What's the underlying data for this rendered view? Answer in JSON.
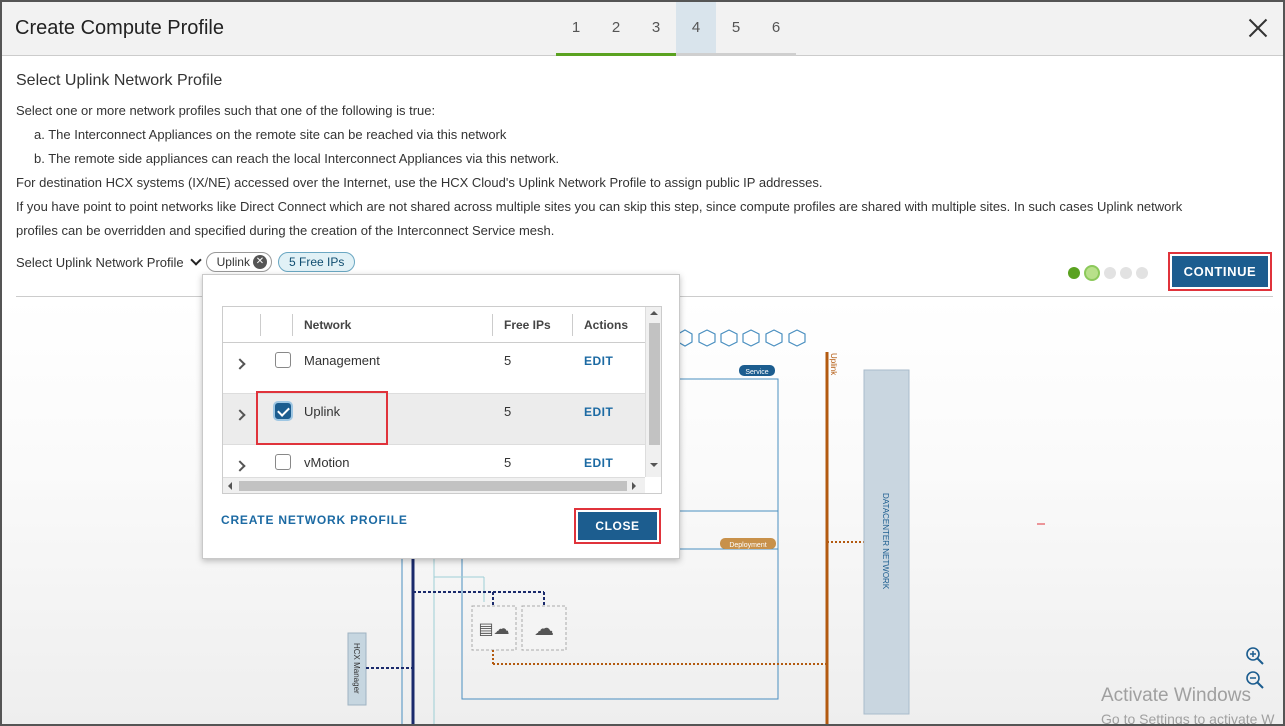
{
  "dialog": {
    "title": "Create Compute Profile",
    "steps": [
      "1",
      "2",
      "3",
      "4",
      "5",
      "6"
    ]
  },
  "content": {
    "section_title": "Select Uplink Network Profile",
    "intro": "Select one or more network profiles such that one of the following is true:",
    "point_a": "a. The Interconnect Appliances on the remote site can be reached via this network",
    "point_b": "b. The remote side appliances can reach the local Interconnect Appliances via this network.",
    "para_internet": "For destination HCX systems (IX/NE) accessed over the Internet, use the HCX Cloud's Uplink Network Profile to assign public IP addresses.",
    "para_p2p_1": "If you have point to point networks like Direct Connect which are not shared across multiple sites you can skip this step, since compute profiles are shared with multiple sites. In such cases Uplink network",
    "para_p2p_2": "profiles can be overridden and specified during the creation of the Interconnect Service mesh.",
    "select_label": "Select Uplink Network Profile",
    "chip_label": "Uplink",
    "free_ips_chip": "5 Free IPs",
    "continue_label": "CONTINUE"
  },
  "popup": {
    "columns": {
      "network": "Network",
      "free_ips": "Free IPs",
      "actions": "Actions"
    },
    "rows": [
      {
        "name": "Management",
        "free_ips": "5",
        "action": "EDIT",
        "checked": false
      },
      {
        "name": "Uplink",
        "free_ips": "5",
        "action": "EDIT",
        "checked": true
      },
      {
        "name": "vMotion",
        "free_ips": "5",
        "action": "EDIT",
        "checked": false
      }
    ],
    "create_link": "CREATE NETWORK PROFILE",
    "close_label": "CLOSE"
  },
  "diagram": {
    "service_badge": "Service",
    "deployment_badge": "Deployment",
    "uplink_label": "Uplink",
    "datacenter_label": "DATACENTER NETWORK",
    "hcx_manager_label": "HCX Manager"
  },
  "watermark": {
    "line1": "Activate Windows",
    "line2": "Go to Settings to activate W"
  },
  "colors": {
    "primary": "#1c5d8f",
    "progress_green": "#5aa220",
    "highlight_red": "#e0333b",
    "uplink_orange": "#b35a10",
    "diagram_blue": "#4a8fc0"
  }
}
